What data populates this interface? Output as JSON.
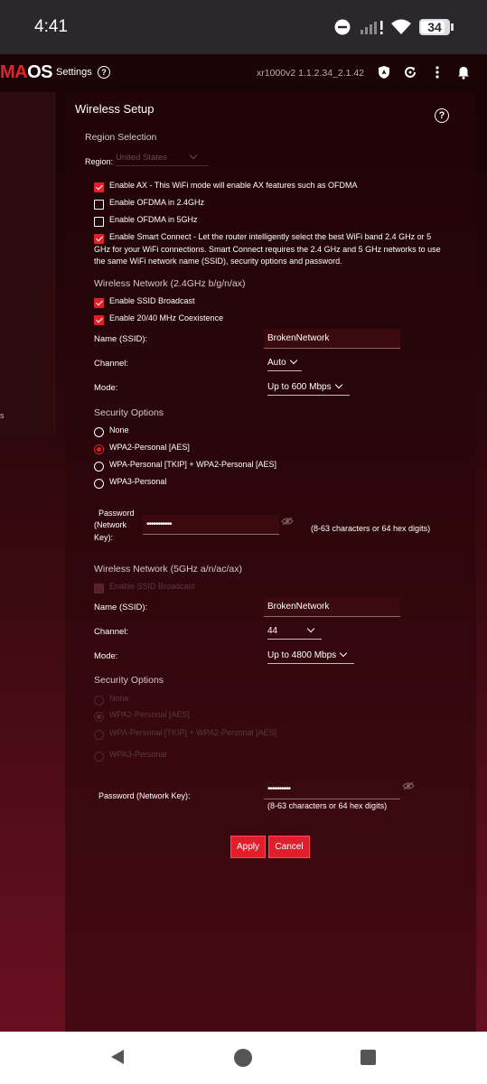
{
  "status_bar": {
    "time": "4:41",
    "battery": "34"
  },
  "header": {
    "logo_left": "MA",
    "logo_right": "OS",
    "settings_label": "Settings",
    "help_glyph": "?",
    "firmware": "xr1000v2 1.1.2.34_2.1.42",
    "icons": [
      "shield-icon",
      "refresh-icon",
      "more-vert-icon",
      "bell-icon"
    ]
  },
  "sidebar": {
    "partial_text": "s"
  },
  "wireless": {
    "title": "Wireless Setup",
    "help_glyph": "?",
    "region_section": "Region Selection",
    "region_label": "Region:",
    "region_value": "United States",
    "options": [
      {
        "label": "Enable AX - This WiFi mode will enable AX features such as OFDMA",
        "checked": true
      },
      {
        "label": "Enable OFDMA in 2.4GHz",
        "checked": false
      },
      {
        "label": "Enable OFDMA in 5GHz",
        "checked": false
      },
      {
        "label": "Enable Smart Connect - Let the router intelligently select the best WiFi band 2.4 GHz or 5 GHz for your WiFi connections. Smart Connect requires the 2.4 GHz and 5 GHz networks to use the same WiFi network name (SSID), security options and password.",
        "checked": true
      }
    ],
    "band24": {
      "section": "Wireless Network (2.4GHz b/g/n/ax)",
      "ssid_broadcast": "Enable SSID Broadcast",
      "coexistence": "Enable 20/40 MHz Coexistence",
      "name_label": "Name (SSID):",
      "name_value": "BrokenNetwork",
      "channel_label": "Channel:",
      "channel_value": "Auto",
      "mode_label": "Mode:",
      "mode_value": "Up to 600 Mbps",
      "security_section": "Security Options",
      "security_options": [
        "None",
        "WPA2-Personal [AES]",
        "WPA-Personal [TKIP] + WPA2-Personal [AES]",
        "WPA3-Personal"
      ],
      "security_selected": "WPA2-Personal [AES]",
      "password_label_1": "Password",
      "password_label_2": "(Network",
      "password_label_3": "Key):",
      "password_value": "•••••••••••",
      "password_hint": "(8-63 characters or 64 hex digits)"
    },
    "band5": {
      "section": "Wireless Network (5GHz a/n/ac/ax)",
      "ssid_broadcast": "Enable SSID Broadcast",
      "name_label": "Name (SSID):",
      "name_value": "BrokenNetwork",
      "channel_label": "Channel:",
      "channel_value": "44",
      "mode_label": "Mode:",
      "mode_value": "Up to 4800 Mbps",
      "security_section": "Security Options",
      "security_options": [
        "None",
        "WPA2-Personal [AES]",
        "WPA-Personal [TKIP] + WPA2-Personal [AES]",
        "WPA3-Personal"
      ],
      "security_selected": "WPA2-Personal [AES]",
      "password_label": "Password (Network Key):",
      "password_value": "••••••••••",
      "password_hint": "(8-63 characters or 64 hex digits)"
    },
    "apply_label": "Apply",
    "cancel_label": "Cancel"
  },
  "colors": {
    "accent": "#e01e2c",
    "header_bg": "#1a0406",
    "nav_bg": "#ffffff"
  }
}
